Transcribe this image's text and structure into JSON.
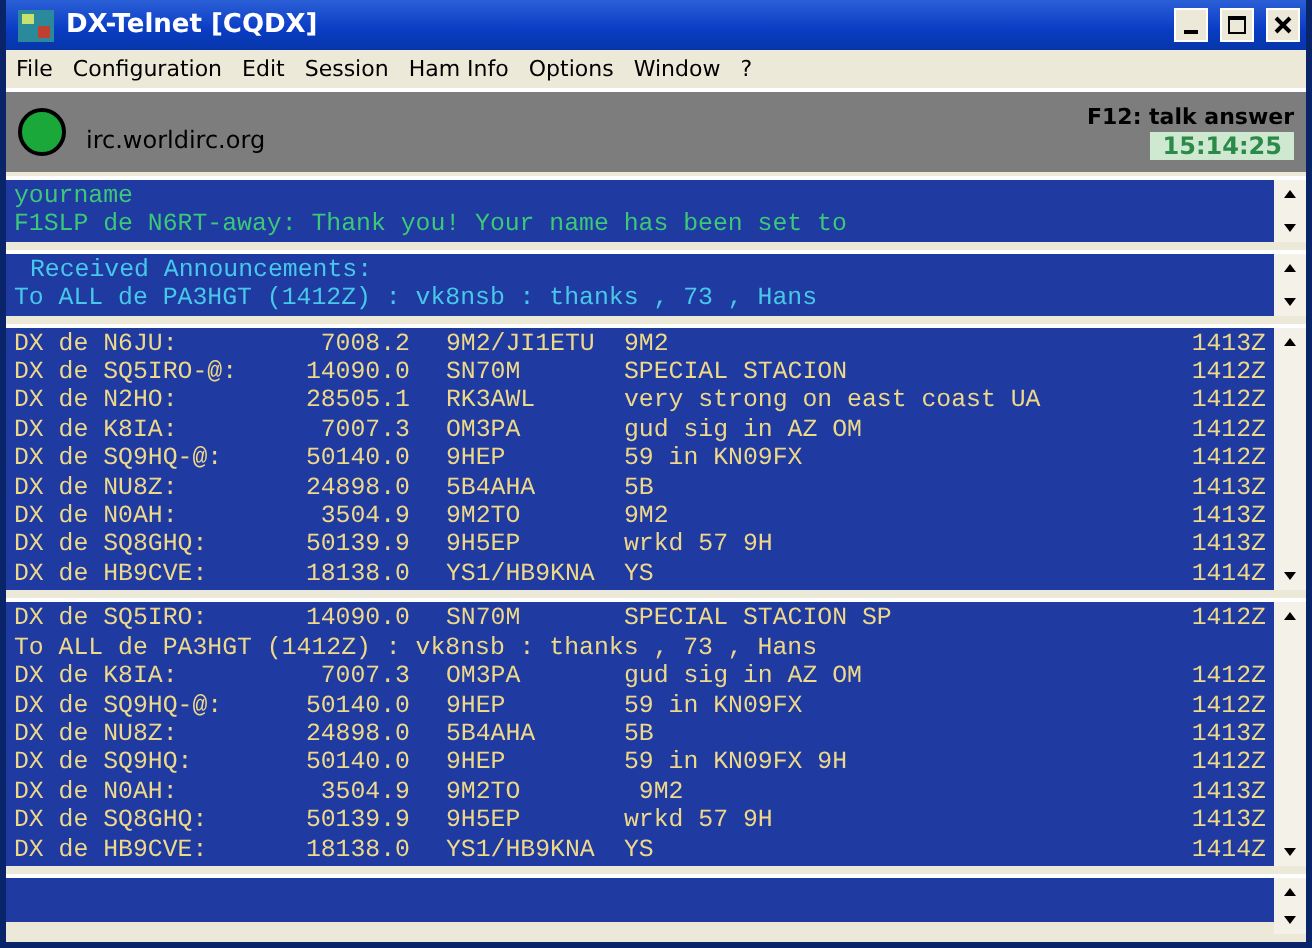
{
  "window": {
    "title": "DX-Telnet [CQDX]"
  },
  "menu": [
    "File",
    "Configuration",
    "Edit",
    "Session",
    "Ham Info",
    "Options",
    "Window",
    "?"
  ],
  "status": {
    "connected": true,
    "server": "irc.worldirc.org",
    "hint": "F12: talk answer",
    "clock": "15:14:25"
  },
  "chat": {
    "lines": [
      "yourname",
      "F1SLP de N6RT-away: Thank you! Your name has been set to"
    ]
  },
  "announcements": {
    "title": "Received Announcements:",
    "lines": [
      "To ALL de PA3HGT (1412Z) : vk8nsb : thanks , 73 , Hans"
    ]
  },
  "spots": [
    {
      "kind": "spot",
      "spotter": "DX de N6JU:",
      "freq": "7008.2",
      "dx": "9M2/JI1ETU",
      "comment": "9M2",
      "time": "1413Z"
    },
    {
      "kind": "spot",
      "spotter": "DX de SQ5IRO-@:",
      "freq": "14090.0",
      "dx": "SN70M",
      "comment": "SPECIAL STACION",
      "time": "1412Z"
    },
    {
      "kind": "spot",
      "spotter": "DX de N2HO:",
      "freq": "28505.1",
      "dx": "RK3AWL",
      "comment": "very strong on east coast UA",
      "time": "1412Z"
    },
    {
      "kind": "spot",
      "spotter": "DX de K8IA:",
      "freq": "7007.3",
      "dx": "OM3PA",
      "comment": "gud sig in AZ OM",
      "time": "1412Z"
    },
    {
      "kind": "spot",
      "spotter": "DX de SQ9HQ-@:",
      "freq": "50140.0",
      "dx": "9HEP",
      "comment": "59 in KN09FX",
      "time": "1412Z"
    },
    {
      "kind": "spot",
      "spotter": "DX de NU8Z:",
      "freq": "24898.0",
      "dx": "5B4AHA",
      "comment": "5B",
      "time": "1413Z"
    },
    {
      "kind": "spot",
      "spotter": "DX de N0AH:",
      "freq": "3504.9",
      "dx": "9M2TO",
      "comment": "9M2",
      "time": "1413Z"
    },
    {
      "kind": "spot",
      "spotter": "DX de SQ8GHQ:",
      "freq": "50139.9",
      "dx": "9H5EP",
      "comment": "wrkd 57 9H",
      "time": "1413Z"
    },
    {
      "kind": "spot",
      "spotter": "DX de HB9CVE:",
      "freq": "18138.0",
      "dx": "YS1/HB9KNA",
      "comment": "YS",
      "time": "1414Z"
    }
  ],
  "log": [
    {
      "kind": "spot",
      "spotter": "DX de SQ5IRO:",
      "freq": "14090.0",
      "dx": "SN70M",
      "comment": "SPECIAL STACION SP",
      "time": "1412Z"
    },
    {
      "kind": "announcement",
      "text": "To ALL de PA3HGT (1412Z) : vk8nsb : thanks , 73 , Hans"
    },
    {
      "kind": "spot",
      "spotter": "DX de K8IA:",
      "freq": "7007.3",
      "dx": "OM3PA",
      "comment": "gud sig in AZ OM",
      "time": "1412Z"
    },
    {
      "kind": "spot",
      "spotter": "DX de SQ9HQ-@:",
      "freq": "50140.0",
      "dx": "9HEP",
      "comment": "59 in KN09FX",
      "time": "1412Z"
    },
    {
      "kind": "spot",
      "spotter": "DX de NU8Z:",
      "freq": "24898.0",
      "dx": "5B4AHA",
      "comment": "5B",
      "time": "1413Z"
    },
    {
      "kind": "spot",
      "spotter": "DX de SQ9HQ:",
      "freq": "50140.0",
      "dx": "9HEP",
      "comment": "59 in KN09FX 9H",
      "time": "1412Z"
    },
    {
      "kind": "spot",
      "spotter": "DX de N0AH:",
      "freq": "3504.9",
      "dx": "9M2TO",
      "comment": " 9M2",
      "time": "1413Z"
    },
    {
      "kind": "spot",
      "spotter": "DX de SQ8GHQ:",
      "freq": "50139.9",
      "dx": "9H5EP",
      "comment": "wrkd 57 9H",
      "time": "1413Z"
    },
    {
      "kind": "spot",
      "spotter": "DX de HB9CVE:",
      "freq": "18138.0",
      "dx": "YS1/HB9KNA",
      "comment": "YS",
      "time": "1414Z"
    }
  ]
}
